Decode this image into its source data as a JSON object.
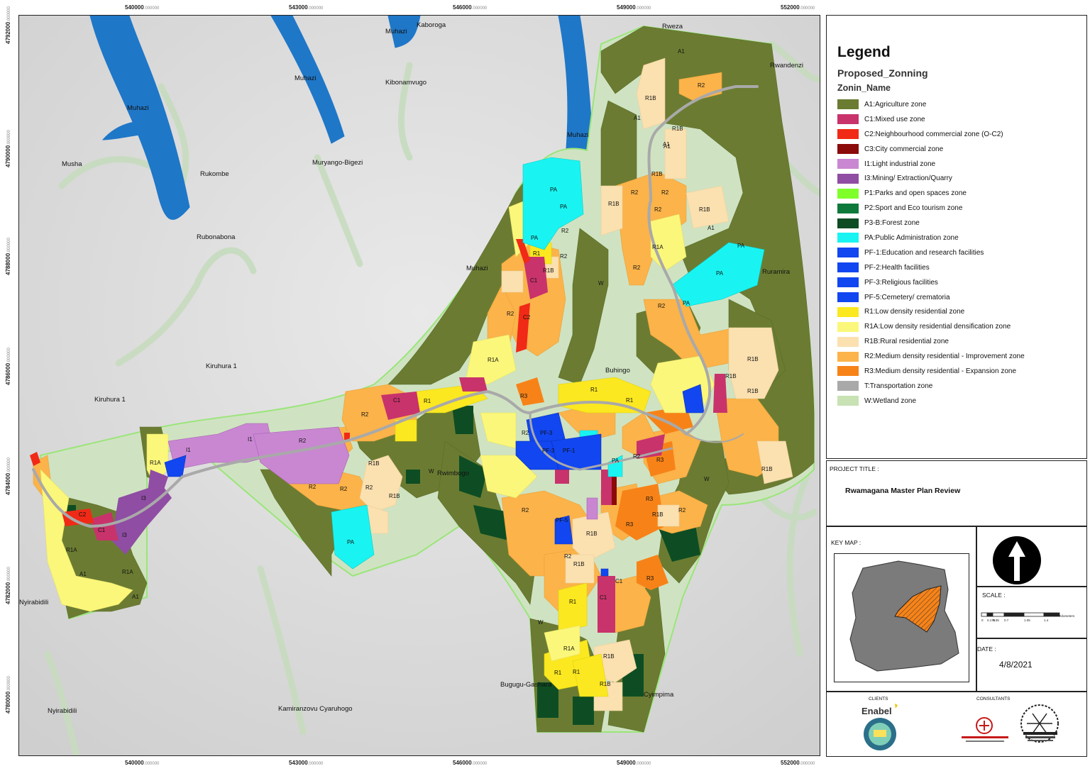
{
  "coords": {
    "easting": [
      "540000",
      "543000",
      "546000",
      "549000",
      "552000"
    ],
    "northing": [
      "4792000",
      "4790000",
      "4788000",
      "4786000",
      "4784000",
      "4782000",
      "4780000"
    ],
    "fraction": ".000000"
  },
  "places": [
    {
      "name": "Muhazi"
    },
    {
      "name": "Kaboroga"
    },
    {
      "name": "Muhazi"
    },
    {
      "name": "Kibonamvugo"
    },
    {
      "name": "Muhazi"
    },
    {
      "name": "Muhazi"
    },
    {
      "name": "Rweza"
    },
    {
      "name": "Rwandenzi"
    },
    {
      "name": "Musha"
    },
    {
      "name": "Rukombe"
    },
    {
      "name": "Muryango-Bigezi"
    },
    {
      "name": "Rubonabona"
    },
    {
      "name": "Muhazi"
    },
    {
      "name": "Ruramira"
    },
    {
      "name": "Kiruhura 1"
    },
    {
      "name": "Buhingo"
    },
    {
      "name": "Kiruhura 1"
    },
    {
      "name": "Rwimbogo"
    },
    {
      "name": "Nyirabidili"
    },
    {
      "name": "Bugugu-Gashara"
    },
    {
      "name": "Cyimpima"
    },
    {
      "name": "Nyirabidili"
    },
    {
      "name": "Kamiranzovu Cyaruhogo"
    }
  ],
  "zone_labels": [
    {
      "code": "A1"
    },
    {
      "code": "R2"
    },
    {
      "code": "R1B"
    },
    {
      "code": "A1"
    },
    {
      "code": "A1"
    },
    {
      "code": "R1B"
    },
    {
      "code": "A1"
    },
    {
      "code": "R1B"
    },
    {
      "code": "R2"
    },
    {
      "code": "R2"
    },
    {
      "code": "R1B"
    },
    {
      "code": "R1B"
    },
    {
      "code": "R2"
    },
    {
      "code": "A1"
    },
    {
      "code": "PA"
    },
    {
      "code": "PA"
    },
    {
      "code": "PA"
    },
    {
      "code": "R2"
    },
    {
      "code": "R1"
    },
    {
      "code": "R2"
    },
    {
      "code": "R1B"
    },
    {
      "code": "C1"
    },
    {
      "code": "R1A"
    },
    {
      "code": "R2"
    },
    {
      "code": "PA"
    },
    {
      "code": "PA"
    },
    {
      "code": "PA"
    },
    {
      "code": "R2"
    },
    {
      "code": "C2"
    },
    {
      "code": "R2"
    },
    {
      "code": "R1A"
    },
    {
      "code": "R1B"
    },
    {
      "code": "R1"
    },
    {
      "code": "R1"
    },
    {
      "code": "C1"
    },
    {
      "code": "R1"
    },
    {
      "code": "R3"
    },
    {
      "code": "R2"
    },
    {
      "code": "I1"
    },
    {
      "code": "I1"
    },
    {
      "code": "R2"
    },
    {
      "code": "R2"
    },
    {
      "code": "PF-3"
    },
    {
      "code": "PF-3"
    },
    {
      "code": "PF-1"
    },
    {
      "code": "R2"
    },
    {
      "code": "PA"
    },
    {
      "code": "R3"
    },
    {
      "code": "R2"
    },
    {
      "code": "R2"
    },
    {
      "code": "R2"
    },
    {
      "code": "R1B"
    },
    {
      "code": "R1B"
    },
    {
      "code": "PA"
    },
    {
      "code": "C2"
    },
    {
      "code": "C1"
    },
    {
      "code": "I3"
    },
    {
      "code": "I3"
    },
    {
      "code": "R1A"
    },
    {
      "code": "A1"
    },
    {
      "code": "R1A"
    },
    {
      "code": "R1A"
    },
    {
      "code": "A1"
    },
    {
      "code": "R3"
    },
    {
      "code": "R3"
    },
    {
      "code": "R2"
    },
    {
      "code": "R1B"
    },
    {
      "code": "R2"
    },
    {
      "code": "PF-5"
    },
    {
      "code": "R1B"
    },
    {
      "code": "R2"
    },
    {
      "code": "R1B"
    },
    {
      "code": "C1"
    },
    {
      "code": "C1"
    },
    {
      "code": "R1"
    },
    {
      "code": "R1A"
    },
    {
      "code": "R1"
    },
    {
      "code": "R1"
    },
    {
      "code": "R1B"
    },
    {
      "code": "R1B"
    },
    {
      "code": "R3"
    },
    {
      "code": "W"
    },
    {
      "code": "W"
    },
    {
      "code": "W"
    },
    {
      "code": "W"
    },
    {
      "code": "R1B"
    },
    {
      "code": "R1B"
    },
    {
      "code": "R1B"
    }
  ],
  "legend": {
    "title": "Legend",
    "subtitle": "Proposed_Zonning",
    "field": "Zonin_Name",
    "items": [
      {
        "label": "A1:Agriculture zone",
        "color": "#6b7c32"
      },
      {
        "label": "C1:Mixed use zone",
        "color": "#c8336b"
      },
      {
        "label": "C2:Neighbourhood commercial zone (O-C2)",
        "color": "#f02a16"
      },
      {
        "label": "C3:City commercial zone",
        "color": "#8b0a0a"
      },
      {
        "label": "I1:Light industrial zone",
        "color": "#c987d2"
      },
      {
        "label": "I3:Mining/ Extraction/Quarry",
        "color": "#8f4da3"
      },
      {
        "label": "P1:Parks and open spaces zone",
        "color": "#7fff2a"
      },
      {
        "label": "P2:Sport and Eco tourism zone",
        "color": "#0d7a3c"
      },
      {
        "label": "P3-B:Forest zone",
        "color": "#0e4d23"
      },
      {
        "label": "PA:Public Administration zone",
        "color": "#19f4f2"
      },
      {
        "label": "PF-1:Education and research facilities",
        "color": "#1146f0"
      },
      {
        "label": "PF-2:Health facilities",
        "color": "#1146f0"
      },
      {
        "label": "PF-3:Religious  facilities",
        "color": "#1146f0"
      },
      {
        "label": "PF-5:Cemetery/ crematoria",
        "color": "#1146f0"
      },
      {
        "label": "R1:Low density residential zone",
        "color": "#fbe820"
      },
      {
        "label": "R1A:Low density residential densification zone",
        "color": "#fbf77a"
      },
      {
        "label": "R1B:Rural residential zone",
        "color": "#fbe0b0"
      },
      {
        "label": "R2:Medium density residential - Improvement zone",
        "color": "#fbb34a"
      },
      {
        "label": "R3:Medium density residential - Expansion zone",
        "color": "#f78318"
      },
      {
        "label": "T:Transportation zone",
        "color": "#a9a9a9"
      },
      {
        "label": "W:Wetland zone",
        "color": "#c8e2b4"
      }
    ]
  },
  "project": {
    "heading": "PROJECT TITLE :",
    "name": "Rwamagana Master Plan Review"
  },
  "keymap": {
    "heading": "KEY MAP :"
  },
  "scale": {
    "heading": "SCALE :",
    "ticks": [
      "0",
      "0.175",
      "0.35",
      "0.7",
      "1.05",
      "1.4"
    ],
    "unit": "Kilometers"
  },
  "date": {
    "heading": "DATE :",
    "value": "4/8/2021"
  },
  "logos": {
    "clients_heading": "CLIENTS",
    "consultants_heading": "CONSULTANTS",
    "enabel": "Enabel"
  }
}
